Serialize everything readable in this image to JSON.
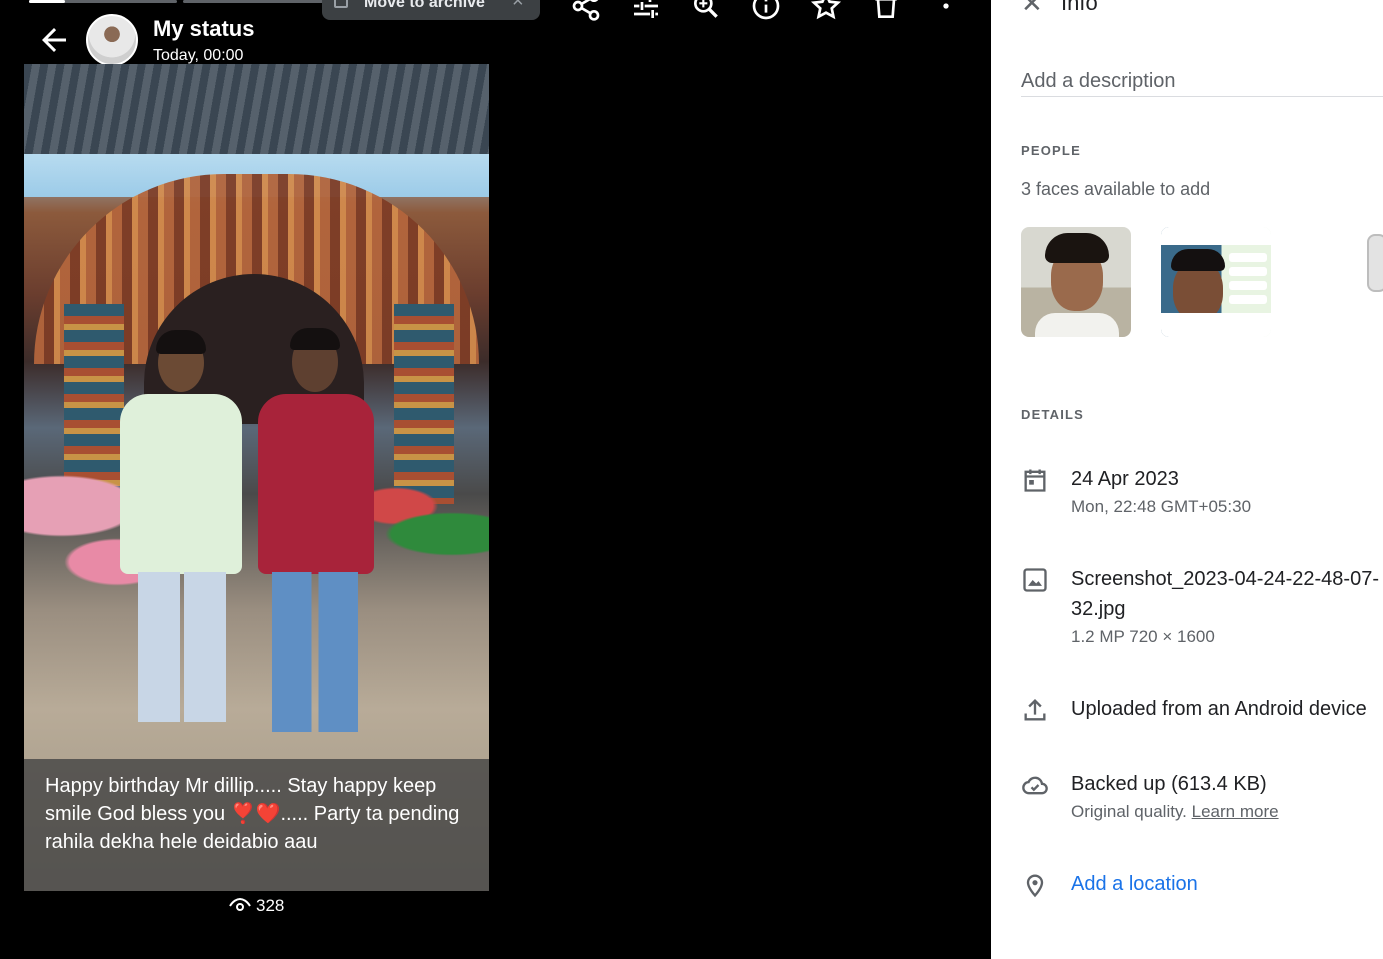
{
  "status": {
    "title": "My status",
    "time": "Today, 00:00",
    "caption": "Happy birthday Mr dillip..... Stay happy keep smile God bless you ❣️❤️..... Party ta pending rahila dekha hele deidabio  aau",
    "views": "328",
    "progress": [
      1.0,
      0.0,
      1.0
    ]
  },
  "toolbar": {
    "archive_label": "Move to archive",
    "icons": [
      "share-icon",
      "edit-adjust-icon",
      "zoom-icon",
      "info-icon",
      "star-icon",
      "delete-icon",
      "more-icon"
    ]
  },
  "info": {
    "title": "Info",
    "description_placeholder": "Add a description",
    "people": {
      "heading": "PEOPLE",
      "faces_text": "3 faces available to add"
    },
    "details": {
      "heading": "DETAILS",
      "date": "24 Apr 2023",
      "date_sub": "Mon, 22:48   GMT+05:30",
      "filename_line1": "Screenshot_2023-04-24-22-48-07-",
      "filename_line2": "32.jpg",
      "file_meta": "1.2 MP   720 × 1600",
      "uploaded": "Uploaded from an Android device",
      "backup": "Backed up (613.4 KB)",
      "backup_quality": "Original quality.",
      "learn_more": "Learn more",
      "add_location": "Add a location"
    }
  },
  "colors": {
    "link_blue": "#1a73e8",
    "viewer_bg": "#000000",
    "panel_bg": "#ffffff"
  }
}
